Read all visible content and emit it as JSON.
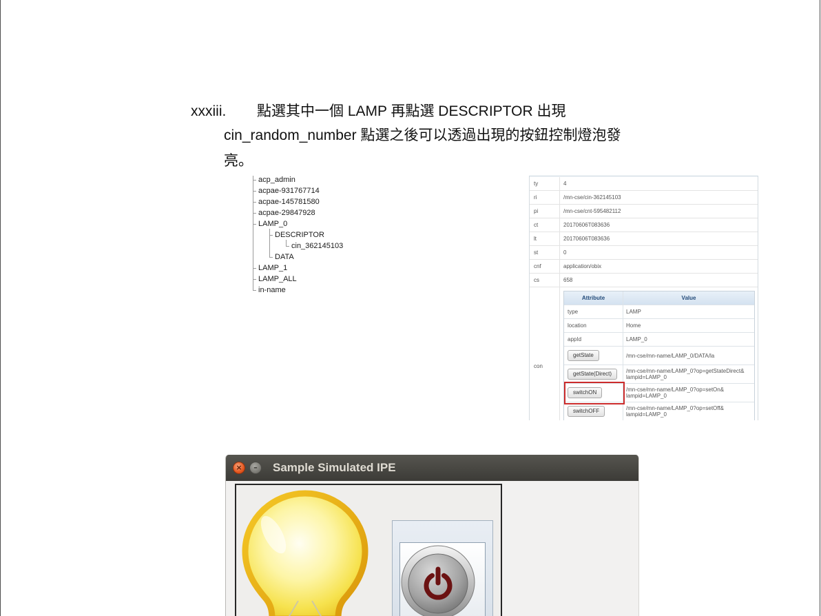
{
  "document": {
    "item_number": "xxxiii.",
    "line1": "點選其中一個 LAMP 再點選 DESCRIPTOR 出現",
    "line2": "cin_random_number 點選之後可以透過出現的按鈕控制燈泡發",
    "line3": "亮。"
  },
  "resource_tree": {
    "items": [
      {
        "label": "acp_admin",
        "depth": 0
      },
      {
        "label": "acpae-931767714",
        "depth": 0
      },
      {
        "label": "acpae-145781580",
        "depth": 0
      },
      {
        "label": "acpae-29847928",
        "depth": 0
      },
      {
        "label": "LAMP_0",
        "depth": 0
      },
      {
        "label": "DESCRIPTOR",
        "depth": 1
      },
      {
        "label": "cin_362145103",
        "depth": 2
      },
      {
        "label": "DATA",
        "depth": 1
      },
      {
        "label": "LAMP_1",
        "depth": 0
      },
      {
        "label": "LAMP_ALL",
        "depth": 0
      },
      {
        "label": "in-name",
        "depth": 0
      }
    ]
  },
  "resource_attributes": {
    "rows": [
      {
        "key": "ty",
        "value": "4"
      },
      {
        "key": "ri",
        "value": "/mn-cse/cin-362145103"
      },
      {
        "key": "pi",
        "value": "/mn-cse/cnt-595482112"
      },
      {
        "key": "ct",
        "value": "20170606T083636"
      },
      {
        "key": "lt",
        "value": "20170606T083636"
      },
      {
        "key": "st",
        "value": "0"
      },
      {
        "key": "cnf",
        "value": "application/obix"
      },
      {
        "key": "cs",
        "value": "658"
      }
    ],
    "con": {
      "key": "con",
      "headers": {
        "attribute": "Attribute",
        "value": "Value"
      },
      "rows": [
        {
          "attribute": "type",
          "value": "LAMP"
        },
        {
          "attribute": "location",
          "value": "Home"
        },
        {
          "attribute": "appId",
          "value": "LAMP_0"
        }
      ],
      "operations": [
        {
          "button": "getState",
          "value_lines": [
            "/mn-cse/mn-name/LAMP_0/DATA/la"
          ],
          "highlighted": false
        },
        {
          "button": "getState(Direct)",
          "value_lines": [
            "/mn-cse/mn-name/LAMP_0?op=getStateDirect&",
            "lampid=LAMP_0"
          ],
          "highlighted": false
        },
        {
          "button": "switchON",
          "value_lines": [
            "/mn-cse/mn-name/LAMP_0?op=setOn&",
            "lampid=LAMP_0"
          ],
          "highlighted": true
        },
        {
          "button": "switchOFF",
          "value_lines": [
            "/mn-cse/mn-name/LAMP_0?op=setOff&",
            "lampid=LAMP_0"
          ],
          "highlighted": false
        }
      ]
    }
  },
  "ipe_window": {
    "title": "Sample Simulated IPE",
    "icons": {
      "close": "close-icon",
      "minimize": "minimize-icon",
      "lamp": "lightbulb-icon",
      "power_button": "power-icon"
    }
  },
  "colors": {
    "highlight_box": "#cc2b2b",
    "table_header_bg": "#d4e2f0",
    "table_header_text": "#234b7a",
    "titlebar": "#3c3b37",
    "lamp_glow": "#f6e24e",
    "lamp_rim": "#e0a90c",
    "power_symbol": "#6b1212"
  }
}
